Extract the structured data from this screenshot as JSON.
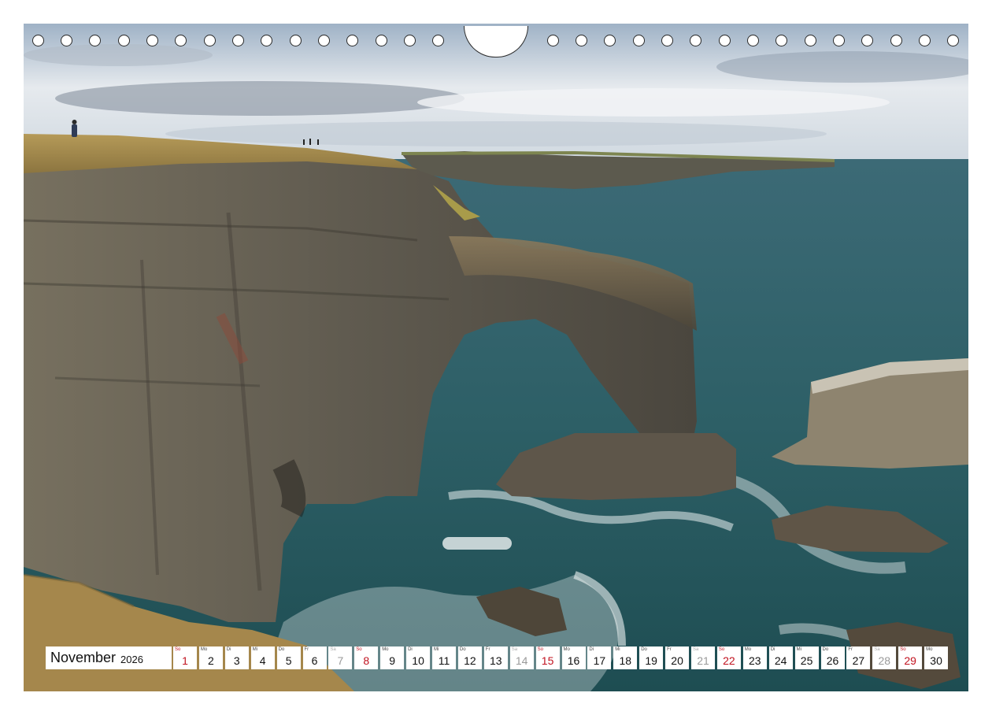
{
  "calendar": {
    "month": "November",
    "year": "2026",
    "days": [
      {
        "wd": "So",
        "d": "1",
        "type": "sun"
      },
      {
        "wd": "Mo",
        "d": "2",
        "type": "weekday"
      },
      {
        "wd": "Di",
        "d": "3",
        "type": "weekday"
      },
      {
        "wd": "Mi",
        "d": "4",
        "type": "weekday"
      },
      {
        "wd": "Do",
        "d": "5",
        "type": "weekday"
      },
      {
        "wd": "Fr",
        "d": "6",
        "type": "weekday"
      },
      {
        "wd": "Sa",
        "d": "7",
        "type": "sat"
      },
      {
        "wd": "So",
        "d": "8",
        "type": "sun"
      },
      {
        "wd": "Mo",
        "d": "9",
        "type": "weekday"
      },
      {
        "wd": "Di",
        "d": "10",
        "type": "weekday"
      },
      {
        "wd": "Mi",
        "d": "11",
        "type": "weekday"
      },
      {
        "wd": "Do",
        "d": "12",
        "type": "weekday"
      },
      {
        "wd": "Fr",
        "d": "13",
        "type": "weekday"
      },
      {
        "wd": "Sa",
        "d": "14",
        "type": "sat"
      },
      {
        "wd": "So",
        "d": "15",
        "type": "sun"
      },
      {
        "wd": "Mo",
        "d": "16",
        "type": "weekday"
      },
      {
        "wd": "Di",
        "d": "17",
        "type": "weekday"
      },
      {
        "wd": "Mi",
        "d": "18",
        "type": "weekday"
      },
      {
        "wd": "Do",
        "d": "19",
        "type": "weekday"
      },
      {
        "wd": "Fr",
        "d": "20",
        "type": "weekday"
      },
      {
        "wd": "Sa",
        "d": "21",
        "type": "sat"
      },
      {
        "wd": "So",
        "d": "22",
        "type": "sun"
      },
      {
        "wd": "Mo",
        "d": "23",
        "type": "weekday"
      },
      {
        "wd": "Di",
        "d": "24",
        "type": "weekday"
      },
      {
        "wd": "Mi",
        "d": "25",
        "type": "weekday"
      },
      {
        "wd": "Do",
        "d": "26",
        "type": "weekday"
      },
      {
        "wd": "Fr",
        "d": "27",
        "type": "weekday"
      },
      {
        "wd": "Sa",
        "d": "28",
        "type": "sat"
      },
      {
        "wd": "So",
        "d": "29",
        "type": "sun"
      },
      {
        "wd": "Mo",
        "d": "30",
        "type": "weekday"
      }
    ]
  },
  "colors": {
    "sunday": "#c1121f",
    "saturday": "#9a9a9a",
    "sea": "#2f5c63",
    "cliff": "#6a6358",
    "grass": "#9c8a4c",
    "sky": "#dfe5ec"
  }
}
